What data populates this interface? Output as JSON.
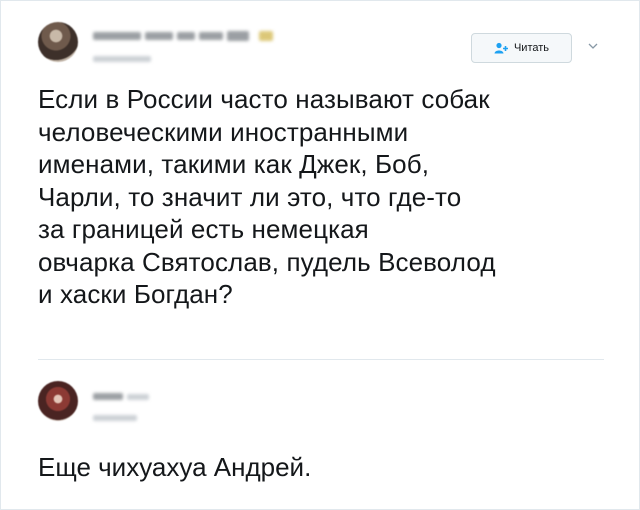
{
  "main_tweet": {
    "follow_button_label": "Читать",
    "text": "Если в России часто называют собак\nчеловеческими иностранными\nименами, такими как Джек, Боб,\nЧарли, то значит ли это, что где-то\nза границей есть немецкая\nовчарка Святослав, пудель Всеволод\nи хаски Богдан?"
  },
  "reply_tweet": {
    "text": "Еще чихуахуа Андрей."
  },
  "colors": {
    "text": "#14171a",
    "divider": "#e1e8ed",
    "follow_accent": "#1da1f2"
  },
  "icons": [
    "avatar",
    "follow-person-plus-icon",
    "chevron-down-icon",
    "verified-badge-icon"
  ]
}
